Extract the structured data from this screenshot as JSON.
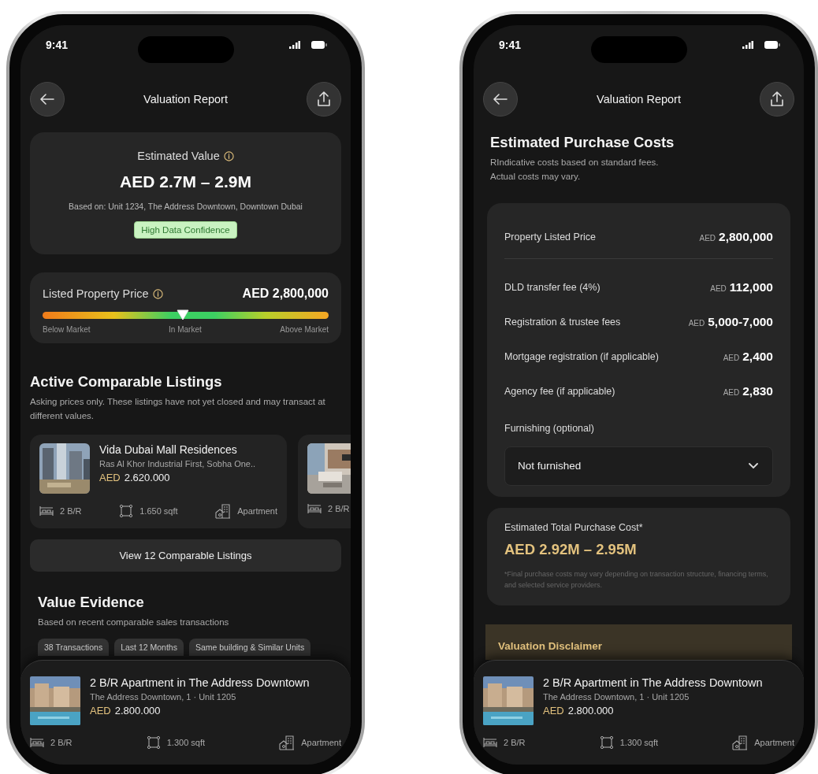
{
  "screens": [
    {
      "status_bar": {
        "time": "9:41"
      },
      "header": {
        "title": "Valuation Report"
      },
      "content": [
        {
          "kind": "estimate",
          "title": "Estimated Value",
          "value": "AED 2.7M – 2.9M",
          "basis": "Based on: Unit 1234, The Address Downtown, Downtown Dubai",
          "badge": "High Data Confidence"
        },
        {
          "kind": "price_meter",
          "label": "Listed Property Price",
          "price": "AED 2,800,000",
          "level": 0.49,
          "scale": [
            "Below Market",
            "In Market",
            "Above Market"
          ]
        },
        {
          "kind": "listings",
          "title": "Active Comparable Listings",
          "description": "Asking prices only. These listings have not yet closed and may transact at different values.",
          "cards": [
            {
              "name": "Vida Dubai Mall Residences",
              "location": "Ras Al Khor Industrial First, Sobha One..",
              "currency": "AED",
              "price": "2.620.000",
              "specs": [
                {
                  "kind": "beds",
                  "text": "2 B/R"
                },
                {
                  "kind": "area",
                  "text": "1.650 sqft"
                },
                {
                  "kind": "type",
                  "text": "Apartment"
                }
              ]
            },
            {
              "specs": [
                {
                  "kind": "beds",
                  "text": "2 B/R"
                }
              ]
            }
          ]
        },
        {
          "kind": "button",
          "label": "View 12 Comparable Listings"
        },
        {
          "kind": "evidence",
          "title": "Value Evidence",
          "description": "Based on recent comparable sales transactions",
          "chips": [
            "38 Transactions",
            "Last 12 Months",
            "Same building & Similar Units"
          ]
        }
      ],
      "bottom_card": {
        "name": "2 B/R Apartment in The Address Downtown",
        "location": "The Address Downtown, 1 · Unit 1205",
        "currency": "AED",
        "price": "2.800.000",
        "specs": [
          {
            "kind": "beds",
            "text": "2 B/R"
          },
          {
            "kind": "area",
            "text": "1.300 sqft"
          },
          {
            "kind": "type",
            "text": "Apartment"
          }
        ]
      }
    },
    {
      "status_bar": {
        "time": "9:41"
      },
      "header": {
        "title": "Valuation Report"
      },
      "content": [
        {
          "kind": "costs",
          "title": "Estimated Purchase Costs",
          "description": "RIndicative costs based on standard fees.\nActual costs may vary.",
          "rows": [
            {
              "label": "Property Listed Price",
              "currency": "AED",
              "amount": "2,800,000",
              "divider": true
            },
            {
              "label": "DLD transfer fee (4%)",
              "currency": "AED",
              "amount": "112,000",
              "divider": false
            },
            {
              "label": "Registration & trustee fees",
              "currency": "AED",
              "amount": "5,000-7,000",
              "divider": false
            },
            {
              "label": "Mortgage registration (if applicable)",
              "currency": "AED",
              "amount": "2,400",
              "divider": false
            },
            {
              "label": "Agency fee (if applicable)",
              "currency": "AED",
              "amount": "2,830",
              "divider": false
            }
          ],
          "furnishing": {
            "label": "Furnishing (optional)",
            "value": "Not furnished"
          }
        },
        {
          "kind": "total",
          "label": "Estimated Total Purchase Cost*",
          "value": "AED 2.92M – 2.95M",
          "note": "*Final purchase costs may vary depending on transaction structure, financing terms, and selected service providers."
        },
        {
          "kind": "disclaimer",
          "title": "Valuation Disclaimer"
        }
      ],
      "bottom_card": {
        "name": "2 B/R Apartment in The Address Downtown",
        "location": "The Address Downtown, 1 · Unit 1205",
        "currency": "AED",
        "price": "2.800.000",
        "specs": [
          {
            "kind": "beds",
            "text": "2 B/R"
          },
          {
            "kind": "area",
            "text": "1.300 sqft"
          },
          {
            "kind": "type",
            "text": "Apartment"
          }
        ]
      }
    }
  ]
}
